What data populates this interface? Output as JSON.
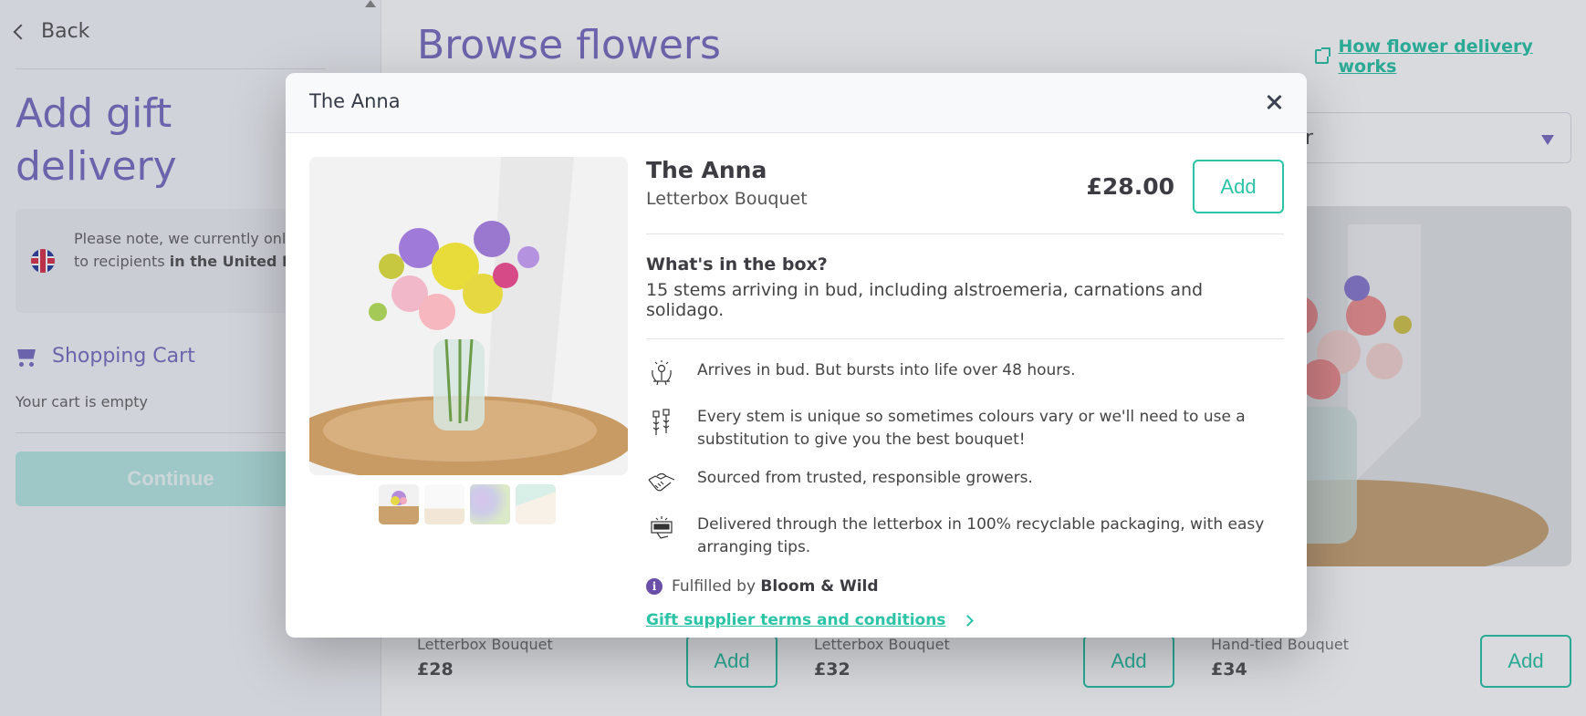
{
  "sidebar": {
    "back_label": "Back",
    "title": "Add gift delivery",
    "notice": {
      "text": "Please note, we currently only deliver to recipients",
      "bold": "in the United Kingdom",
      "icon": "uk-flag-icon"
    },
    "cart": {
      "title": "Shopping Cart",
      "empty_text": "Your cart is empty",
      "icon": "shopping-cart-icon"
    },
    "continue_label": "Continue"
  },
  "main": {
    "title": "Browse flowers",
    "how_link": "How flower delivery works",
    "sort": {
      "selected": "Sort by popular"
    },
    "products": [
      {
        "type": "Letterbox Bouquet",
        "price": "£28",
        "add_label": "Add"
      },
      {
        "type": "Letterbox Bouquet",
        "price": "£32",
        "add_label": "Add"
      },
      {
        "type": "Hand-tied Bouquet",
        "price": "£34",
        "add_label": "Add"
      }
    ]
  },
  "modal": {
    "title": "The Anna",
    "product": {
      "name": "The Anna",
      "type": "Letterbox Bouquet",
      "price": "£28.00",
      "add_label": "Add"
    },
    "box": {
      "heading": "What's in the box?",
      "text": "15 stems arriving in bud, including alstroemeria, carnations and solidago."
    },
    "features": [
      {
        "icon": "blooming-hands-icon",
        "text": "Arrives in bud. But bursts into life over 48 hours."
      },
      {
        "icon": "unique-stems-icon",
        "text": "Every stem is unique so sometimes colours vary or we'll need to use a substitution to give you the best bouquet!"
      },
      {
        "icon": "handshake-icon",
        "text": "Sourced from trusted, responsible growers."
      },
      {
        "icon": "letterbox-icon",
        "text": "Delivered through the letterbox in 100% recyclable packaging, with easy arranging tips."
      }
    ],
    "fulfilled_prefix": "Fulfilled by",
    "fulfilled_by": "Bloom & Wild",
    "terms_link": "Gift supplier terms and conditions",
    "thumbnail_count": 4
  },
  "colors": {
    "brand_purple": "#7b6fc2",
    "accent_teal": "#2bc4a6",
    "info_purple": "#6a4fa8"
  }
}
